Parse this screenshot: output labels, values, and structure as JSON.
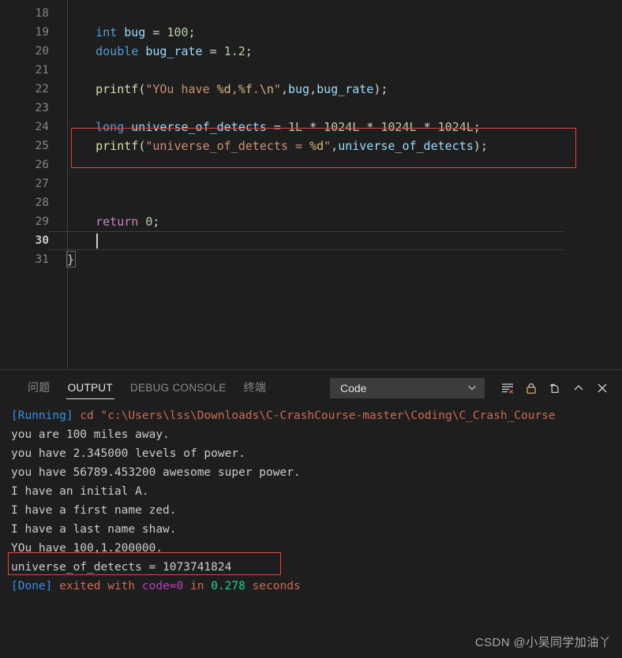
{
  "editor": {
    "first_line_number": 18,
    "current_line": 30,
    "lines": [
      {
        "n": 18,
        "tokens": []
      },
      {
        "n": 19,
        "tokens": [
          {
            "t": "    ",
            "c": "plain"
          },
          {
            "t": "int",
            "c": "kw"
          },
          {
            "t": " ",
            "c": "plain"
          },
          {
            "t": "bug",
            "c": "var"
          },
          {
            "t": " ",
            "c": "plain"
          },
          {
            "t": "=",
            "c": "op"
          },
          {
            "t": " ",
            "c": "plain"
          },
          {
            "t": "100",
            "c": "num"
          },
          {
            "t": ";",
            "c": "punc"
          }
        ]
      },
      {
        "n": 20,
        "tokens": [
          {
            "t": "    ",
            "c": "plain"
          },
          {
            "t": "double",
            "c": "kw"
          },
          {
            "t": " ",
            "c": "plain"
          },
          {
            "t": "bug_rate",
            "c": "var"
          },
          {
            "t": " ",
            "c": "plain"
          },
          {
            "t": "=",
            "c": "op"
          },
          {
            "t": " ",
            "c": "plain"
          },
          {
            "t": "1.2",
            "c": "num"
          },
          {
            "t": ";",
            "c": "punc"
          }
        ]
      },
      {
        "n": 21,
        "tokens": []
      },
      {
        "n": 22,
        "tokens": [
          {
            "t": "    ",
            "c": "plain"
          },
          {
            "t": "printf",
            "c": "fn"
          },
          {
            "t": "(",
            "c": "punc"
          },
          {
            "t": "\"YOu have ",
            "c": "str"
          },
          {
            "t": "%d",
            "c": "fmt"
          },
          {
            "t": ",",
            "c": "str"
          },
          {
            "t": "%f",
            "c": "fmt"
          },
          {
            "t": ".",
            "c": "str"
          },
          {
            "t": "\\n",
            "c": "fmt"
          },
          {
            "t": "\"",
            "c": "str"
          },
          {
            "t": ",",
            "c": "punc"
          },
          {
            "t": "bug",
            "c": "var"
          },
          {
            "t": ",",
            "c": "punc"
          },
          {
            "t": "bug_rate",
            "c": "var"
          },
          {
            "t": ")",
            "c": "punc"
          },
          {
            "t": ";",
            "c": "punc"
          }
        ]
      },
      {
        "n": 23,
        "tokens": []
      },
      {
        "n": 24,
        "tokens": [
          {
            "t": "    ",
            "c": "plain"
          },
          {
            "t": "long",
            "c": "kw"
          },
          {
            "t": " ",
            "c": "plain"
          },
          {
            "t": "universe_of_detects",
            "c": "var"
          },
          {
            "t": " ",
            "c": "plain"
          },
          {
            "t": "=",
            "c": "op"
          },
          {
            "t": " ",
            "c": "plain"
          },
          {
            "t": "1L",
            "c": "num"
          },
          {
            "t": " ",
            "c": "plain"
          },
          {
            "t": "*",
            "c": "op"
          },
          {
            "t": " ",
            "c": "plain"
          },
          {
            "t": "1024L",
            "c": "num"
          },
          {
            "t": " ",
            "c": "plain"
          },
          {
            "t": "*",
            "c": "op"
          },
          {
            "t": " ",
            "c": "plain"
          },
          {
            "t": "1024L",
            "c": "num"
          },
          {
            "t": " ",
            "c": "plain"
          },
          {
            "t": "*",
            "c": "op"
          },
          {
            "t": " ",
            "c": "plain"
          },
          {
            "t": "1024L",
            "c": "num"
          },
          {
            "t": ";",
            "c": "punc"
          }
        ]
      },
      {
        "n": 25,
        "tokens": [
          {
            "t": "    ",
            "c": "plain"
          },
          {
            "t": "printf",
            "c": "fn"
          },
          {
            "t": "(",
            "c": "punc"
          },
          {
            "t": "\"universe_of_detects = ",
            "c": "str"
          },
          {
            "t": "%d",
            "c": "fmt"
          },
          {
            "t": "\"",
            "c": "str"
          },
          {
            "t": ",",
            "c": "punc"
          },
          {
            "t": "universe_of_detects",
            "c": "var"
          },
          {
            "t": ")",
            "c": "punc"
          },
          {
            "t": ";",
            "c": "punc"
          }
        ]
      },
      {
        "n": 26,
        "tokens": []
      },
      {
        "n": 27,
        "tokens": []
      },
      {
        "n": 28,
        "tokens": []
      },
      {
        "n": 29,
        "tokens": [
          {
            "t": "    ",
            "c": "plain"
          },
          {
            "t": "return",
            "c": "ctrl"
          },
          {
            "t": " ",
            "c": "plain"
          },
          {
            "t": "0",
            "c": "num"
          },
          {
            "t": ";",
            "c": "punc"
          }
        ]
      },
      {
        "n": 30,
        "tokens": []
      },
      {
        "n": 31,
        "tokens": [
          {
            "t": "}",
            "c": "punc"
          }
        ]
      }
    ],
    "annotation_label": "code-highlight-box"
  },
  "panel": {
    "tabs": [
      {
        "label": "问题",
        "active": false,
        "cjk": true
      },
      {
        "label": "OUTPUT",
        "active": true,
        "cjk": false
      },
      {
        "label": "DEBUG CONSOLE",
        "active": false,
        "cjk": false
      },
      {
        "label": "终端",
        "active": false,
        "cjk": true
      }
    ],
    "output_channel": {
      "value": "Code",
      "chevron": "chevron-down-icon"
    },
    "actions": [
      {
        "name": "clear-output-icon",
        "title": "Clear Output"
      },
      {
        "name": "lock-scroll-icon",
        "title": "Turn Auto Scrolling Off"
      },
      {
        "name": "open-in-editor-icon",
        "title": "Open Output in Editor"
      },
      {
        "name": "collapse-panel-icon",
        "title": "Hide Panel"
      },
      {
        "name": "close-panel-icon",
        "title": "Close Panel"
      }
    ],
    "output_lines": [
      {
        "segs": [
          {
            "t": "[Running] ",
            "c": "o-blue"
          },
          {
            "t": "cd \"c:\\Users\\lss\\Downloads\\C-CrashCourse-master\\Coding\\C_Crash_Course",
            "c": "o-orange"
          }
        ]
      },
      {
        "segs": [
          {
            "t": "you are 100 miles away.",
            "c": ""
          }
        ]
      },
      {
        "segs": [
          {
            "t": "you have 2.345000 levels of power.",
            "c": ""
          }
        ]
      },
      {
        "segs": [
          {
            "t": "you have 56789.453200 awesome super power.",
            "c": ""
          }
        ]
      },
      {
        "segs": [
          {
            "t": "I have an initial A.",
            "c": ""
          }
        ]
      },
      {
        "segs": [
          {
            "t": "I have a first name zed.",
            "c": ""
          }
        ]
      },
      {
        "segs": [
          {
            "t": "I have a last name shaw.",
            "c": ""
          }
        ]
      },
      {
        "segs": [
          {
            "t": "YOu have 100,1.200000.",
            "c": ""
          }
        ]
      },
      {
        "segs": [
          {
            "t": "universe_of_detects = 1073741824",
            "c": ""
          }
        ]
      },
      {
        "segs": [
          {
            "t": "[Done] ",
            "c": "o-blue"
          },
          {
            "t": "exited with ",
            "c": "o-orange"
          },
          {
            "t": "code=0",
            "c": "o-mag"
          },
          {
            "t": " in ",
            "c": "o-orange"
          },
          {
            "t": "0.278",
            "c": "o-green"
          },
          {
            "t": " seconds",
            "c": "o-orange"
          }
        ]
      }
    ]
  },
  "watermark": {
    "text": "CSDN @小吴同学加油丫"
  },
  "colors": {
    "editor_bg": "#1e1e1e",
    "panel_bg": "#1e1e1e",
    "annotation_red": "#e8433e",
    "keyword": "#569cd6",
    "variable": "#9cdcfe",
    "number": "#b5cea8",
    "function": "#dcdcaa",
    "string": "#ce9178",
    "format_spec": "#d7ba7d",
    "control": "#c586c0",
    "line_number": "#858585",
    "output_text": "#cccccc",
    "output_blue": "#3b8eea",
    "output_orange": "#cd6b52",
    "output_magenta": "#bc3fbc",
    "output_green": "#23d18b"
  }
}
